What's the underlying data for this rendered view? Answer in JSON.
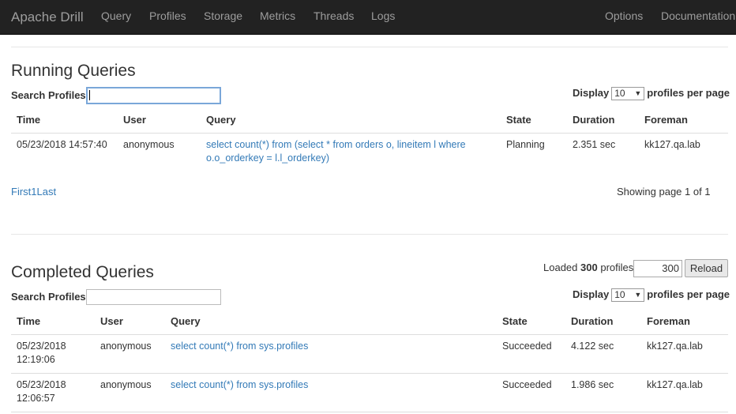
{
  "nav": {
    "brand": "Apache Drill",
    "left": [
      "Query",
      "Profiles",
      "Storage",
      "Metrics",
      "Threads",
      "Logs"
    ],
    "right": [
      "Options",
      "Documentation"
    ]
  },
  "running": {
    "title": "Running Queries",
    "search_label": "Search Profiles",
    "display_label": "Display",
    "display_value": "10",
    "per_page_label": "profiles per page",
    "columns": [
      "Time",
      "User",
      "Query",
      "State",
      "Duration",
      "Foreman"
    ],
    "rows": [
      {
        "time": "05/23/2018 14:57:40",
        "user": "anonymous",
        "query_line1": "select count(*) from (select * from orders o, lineitem l where",
        "query_line2": "o.o_orderkey = l.l_orderkey)",
        "state": "Planning",
        "duration": "2.351 sec",
        "foreman": "kk127.qa.lab"
      }
    ],
    "pager": {
      "first": "First",
      "page": "1",
      "last": "Last"
    },
    "showing": "Showing page 1 of 1"
  },
  "completed": {
    "title": "Completed Queries",
    "loaded_prefix": "Loaded",
    "loaded_count": "300",
    "loaded_suffix": "profiles",
    "max_value": "300",
    "reload_label": "Reload",
    "search_label": "Search Profiles",
    "display_label": "Display",
    "display_value": "10",
    "per_page_label": "profiles per page",
    "columns": [
      "Time",
      "User",
      "Query",
      "State",
      "Duration",
      "Foreman"
    ],
    "rows": [
      {
        "date": "05/23/2018",
        "clock": "12:19:06",
        "user": "anonymous",
        "query": "select count(*) from sys.profiles",
        "state": "Succeeded",
        "duration": "4.122 sec",
        "foreman": "kk127.qa.lab"
      },
      {
        "date": "05/23/2018",
        "clock": "12:06:57",
        "user": "anonymous",
        "query": "select count(*) from sys.profiles",
        "state": "Succeeded",
        "duration": "1.986 sec",
        "foreman": "kk127.qa.lab"
      }
    ]
  }
}
